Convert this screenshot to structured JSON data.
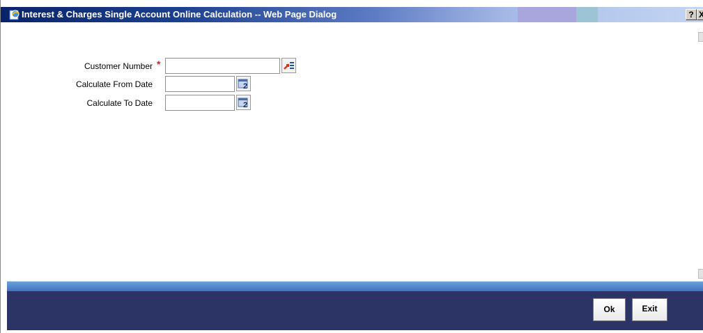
{
  "window": {
    "title": "Interest & Charges Single Account Online Calculation -- Web Page Dialog",
    "help_label": "?",
    "close_label": "X"
  },
  "form": {
    "customer_number": {
      "label": "Customer Number",
      "required_mark": "*",
      "value": "",
      "button_icon": "list-of-values-icon"
    },
    "calculate_from_date": {
      "label": "Calculate From Date",
      "value": "",
      "button_icon": "calendar-icon"
    },
    "calculate_to_date": {
      "label": "Calculate To Date",
      "value": "",
      "button_icon": "calendar-icon"
    }
  },
  "footer": {
    "ok_label": "Ok",
    "exit_label": "Exit"
  },
  "colors": {
    "title_start": "#0a246a",
    "title_end": "#c4d4f2",
    "footer_bg": "#2b3464",
    "blue_bar": "#3f74c2",
    "required": "#e02020"
  }
}
